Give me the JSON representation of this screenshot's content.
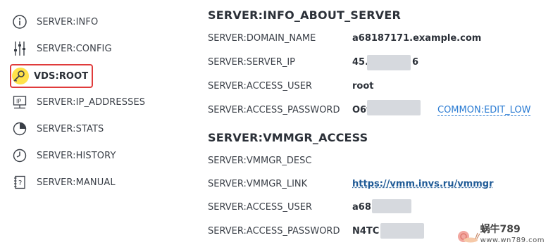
{
  "sidebar": {
    "items": [
      {
        "label": "SERVER:INFO",
        "icon": "info-icon"
      },
      {
        "label": "SERVER:CONFIG",
        "icon": "sliders-icon"
      },
      {
        "label": "VDS:ROOT",
        "icon": "key-icon",
        "active": true
      },
      {
        "label": "SERVER:IP_ADDRESSES",
        "icon": "ip-icon"
      },
      {
        "label": "SERVER:STATS",
        "icon": "pie-chart-icon"
      },
      {
        "label": "SERVER:HISTORY",
        "icon": "clock-icon"
      },
      {
        "label": "SERVER:MANUAL",
        "icon": "manual-icon"
      }
    ]
  },
  "info_section": {
    "title": "SERVER:INFO_ABOUT_SERVER",
    "rows": [
      {
        "label": "SERVER:DOMAIN_NAME",
        "value": "a68187171.example.com"
      },
      {
        "label": "SERVER:SERVER_IP",
        "value": "45.1",
        "value_tail": "6"
      },
      {
        "label": "SERVER:ACCESS_USER",
        "value": "root"
      },
      {
        "label": "SERVER:ACCESS_PASSWORD",
        "value": "O6t",
        "action": "COMMON:EDIT_LOW"
      }
    ]
  },
  "vmmgr_section": {
    "title": "SERVER:VMMGR_ACCESS",
    "rows": [
      {
        "label": "SERVER:VMMGR_DESC",
        "value": ""
      },
      {
        "label": "SERVER:VMMGR_LINK",
        "value": "https://vmm.invs.ru/vmmgr"
      },
      {
        "label": "SERVER:ACCESS_USER",
        "value": "a68"
      },
      {
        "label": "SERVER:ACCESS_PASSWORD",
        "value": "N4TC"
      }
    ]
  },
  "watermark": {
    "text": "蜗牛789",
    "sub": "www.wn789.com"
  },
  "colors": {
    "active_border": "#e03b3b",
    "key_highlight": "#ffe24a",
    "link": "#2a7bd3"
  }
}
